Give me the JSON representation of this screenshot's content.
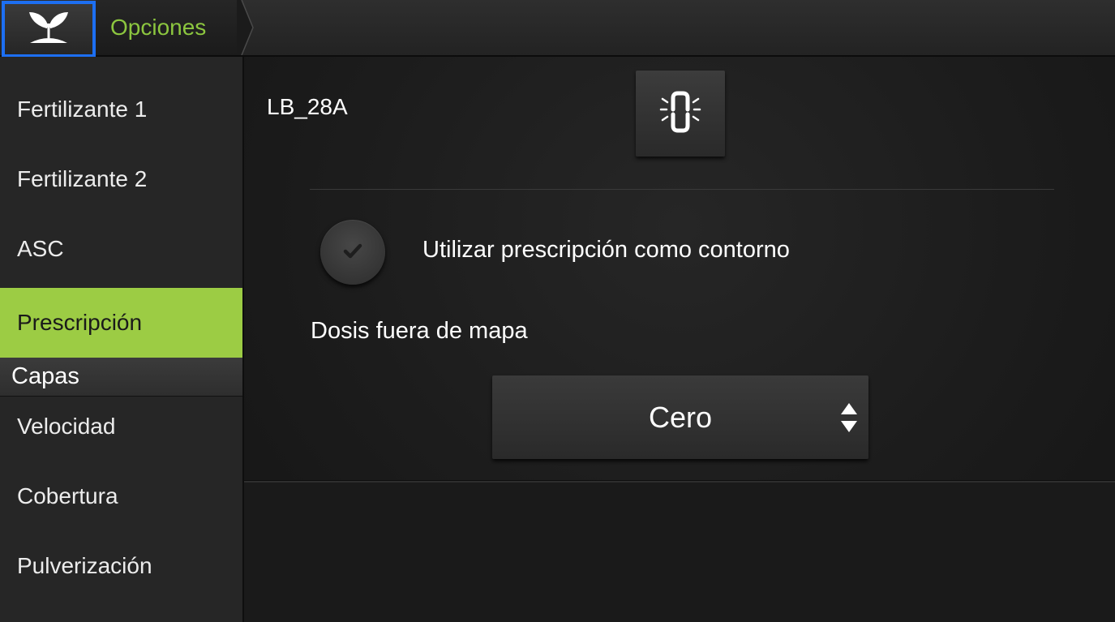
{
  "topbar": {
    "home_icon": "sprout-icon",
    "breadcrumb": "Opciones"
  },
  "sidebar": {
    "items": [
      {
        "label": "Fertilizante 1",
        "active": false
      },
      {
        "label": "Fertilizante 2",
        "active": false
      },
      {
        "label": "ASC",
        "active": false
      },
      {
        "label": "Prescripción",
        "active": true
      }
    ],
    "section_header": "Capas",
    "layer_items": [
      {
        "label": "Velocidad"
      },
      {
        "label": "Cobertura"
      },
      {
        "label": "Pulverización"
      }
    ]
  },
  "main": {
    "device_label": "LB_28A",
    "link_icon": "link-icon",
    "use_prescription_checkbox": {
      "label": "Utilizar prescripción como contorno",
      "checked": true
    },
    "off_map_dose": {
      "label": "Dosis fuera de mapa",
      "selected": "Cero"
    }
  },
  "colors": {
    "accent_green": "#9ccc44",
    "breadcrumb_green": "#8cc63f",
    "focus_blue": "#1d6ff2",
    "background": "#1c1c1c"
  }
}
